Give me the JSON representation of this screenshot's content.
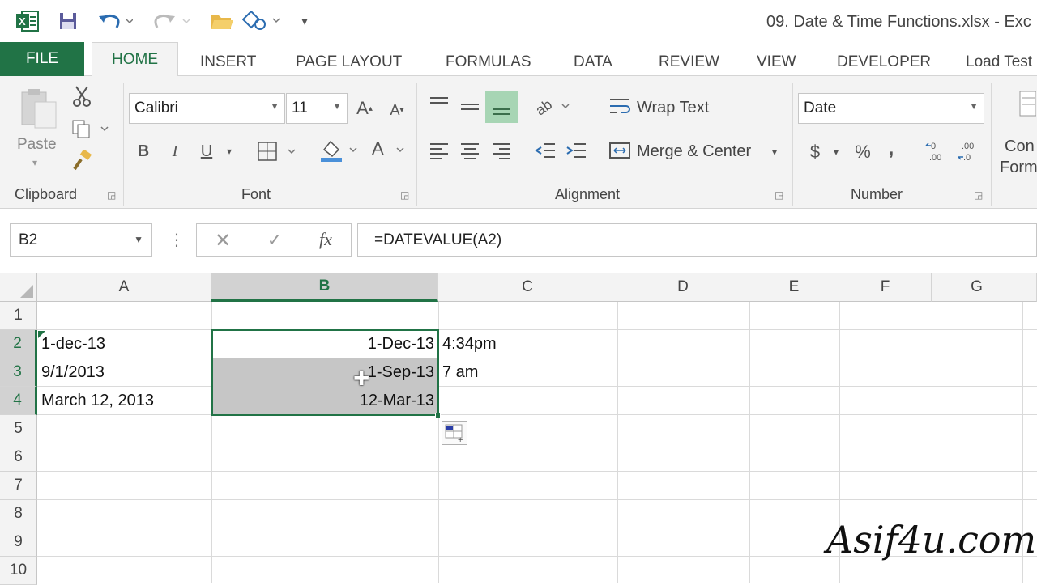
{
  "window": {
    "title": "09. Date & Time Functions.xlsx - Exc",
    "app_icon": "excel-icon"
  },
  "ribbon_tabs": [
    "FILE",
    "HOME",
    "INSERT",
    "PAGE LAYOUT",
    "FORMULAS",
    "DATA",
    "REVIEW",
    "VIEW",
    "DEVELOPER",
    "Load Test"
  ],
  "ribbon": {
    "clipboard": {
      "label": "Clipboard",
      "paste": "Paste"
    },
    "font": {
      "label": "Font",
      "name": "Calibri",
      "size": "11",
      "bold": "B",
      "italic": "I",
      "underline": "U"
    },
    "alignment": {
      "label": "Alignment",
      "wrap_text": "Wrap Text",
      "merge_center": "Merge & Center"
    },
    "number": {
      "label": "Number",
      "format": "Date",
      "currency": "$",
      "percent": "%",
      "comma": ","
    },
    "styles": {
      "line1": "Con",
      "line2": "Form"
    }
  },
  "formula_bar": {
    "name_box": "B2",
    "formula": "=DATEVALUE(A2)"
  },
  "grid": {
    "columns": [
      "A",
      "B",
      "C",
      "D",
      "E",
      "F",
      "G"
    ],
    "rows": [
      "1",
      "2",
      "3",
      "4",
      "5",
      "6",
      "7",
      "8",
      "9",
      "10"
    ],
    "cells": {
      "A2": "1-dec-13",
      "A3": "9/1/2013",
      "A4": "March 12, 2013",
      "B2": "1-Dec-13",
      "B3": "1-Sep-13",
      "B4": "12-Mar-13",
      "C2": "4:34pm",
      "C3": "7 am"
    }
  },
  "watermark": "Asif4u.com",
  "accent_color": "#217346"
}
